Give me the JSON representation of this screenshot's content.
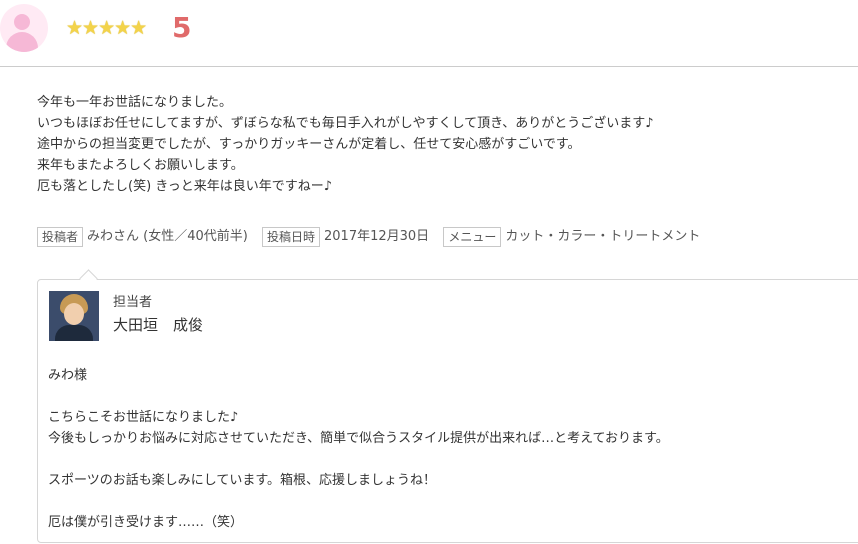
{
  "rating": {
    "stars": "★★★★★",
    "star_count": 5,
    "score": "5"
  },
  "review": {
    "lines": [
      "今年も一年お世話になりました。",
      "いつもほぼお任せにしてますが、ずぼらな私でも毎日手入れがしやすくして頂き、ありがとうございます♪",
      "途中からの担当変更でしたが、すっかりガッキーさんが定着し、任せて安心感がすごいです。",
      "来年もまたよろしくお願いします。",
      "厄も落としたし(笑) きっと来年は良い年ですねー♪"
    ]
  },
  "meta": {
    "poster_tag": "投稿者",
    "poster_value": "みわさん (女性／40代前半)",
    "date_tag": "投稿日時",
    "date_value": "2017年12月30日",
    "menu_tag": "メニュー",
    "menu_value": "カット・カラー・トリートメント"
  },
  "reply": {
    "role": "担当者",
    "name": "大田垣　成俊",
    "lines": [
      "みわ様",
      "",
      "こちらこそお世話になりました♪",
      "今後もしっかりお悩みに対応させていただき、簡単で似合うスタイル提供が出来れば…と考えております。",
      "",
      "スポーツのお話も楽しみにしています。箱根、応援しましょうね！",
      "",
      "厄は僕が引き受けます……（笑）"
    ]
  },
  "colors": {
    "star": "#f3d34a",
    "score": "#e06a6a",
    "avatar_bg": "#ffeaf4",
    "avatar_fg": "#f6b8d6",
    "border": "#d6d6d6"
  }
}
